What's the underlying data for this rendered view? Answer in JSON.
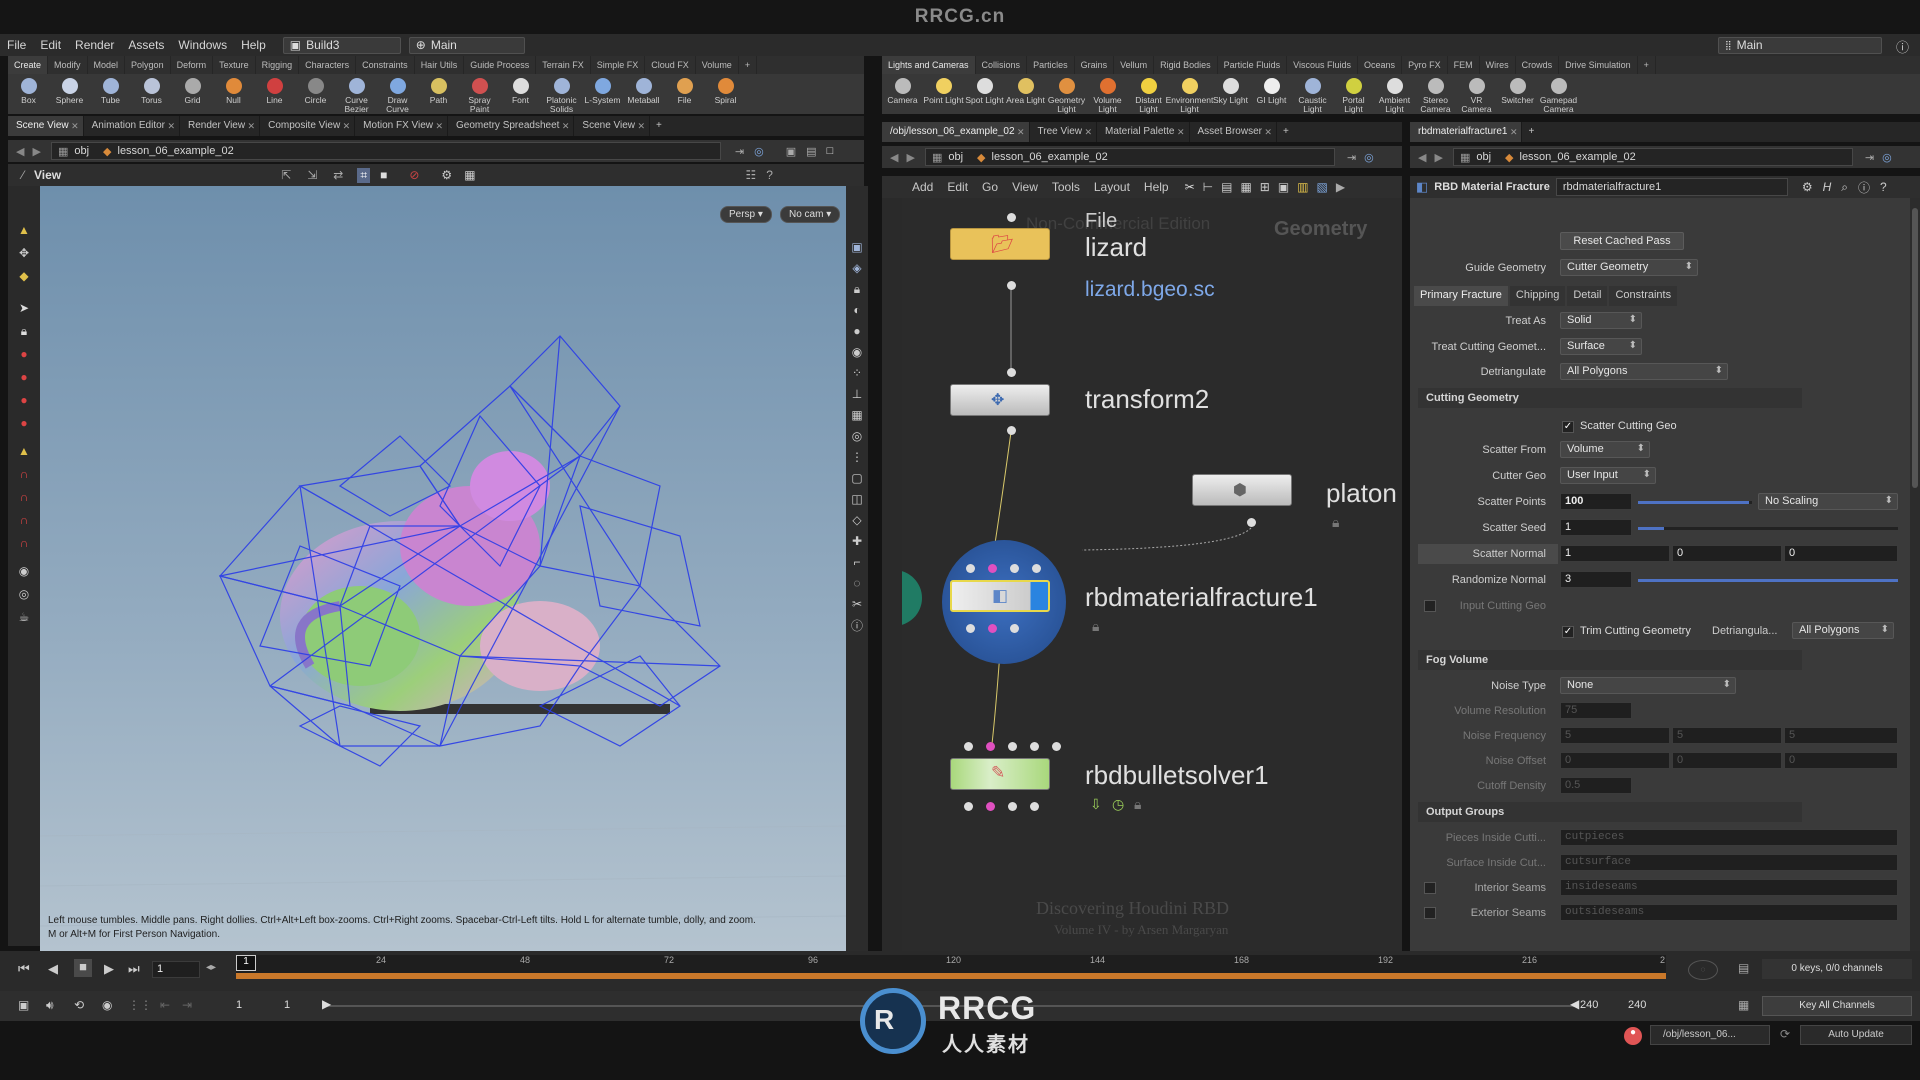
{
  "watermark_title": "RRCG.cn",
  "menubar": {
    "items": [
      "File",
      "Edit",
      "Render",
      "Assets",
      "Windows",
      "Help"
    ],
    "build_desktop": "Build3",
    "main_desktop": "Main",
    "right_desktop": "Main"
  },
  "shelf_left": {
    "tabs": [
      "Create",
      "Modify",
      "Model",
      "Polygon",
      "Deform",
      "Texture",
      "Rigging",
      "Characters",
      "Constraints",
      "Hair Utils",
      "Guide Process",
      "Terrain FX",
      "Simple FX",
      "Cloud FX",
      "Volume"
    ],
    "tools": [
      {
        "label": "Box",
        "icon": "box-icon",
        "color": "#9fb4d8"
      },
      {
        "label": "Sphere",
        "icon": "sphere-icon",
        "color": "#c9d3e6"
      },
      {
        "label": "Tube",
        "icon": "tube-icon",
        "color": "#9fb4d8"
      },
      {
        "label": "Torus",
        "icon": "torus-icon",
        "color": "#b9c3d8"
      },
      {
        "label": "Grid",
        "icon": "grid-icon",
        "color": "#aaaaaa"
      },
      {
        "label": "Null",
        "icon": "null-icon",
        "color": "#e08a3a"
      },
      {
        "label": "Line",
        "icon": "line-icon",
        "color": "#d04040"
      },
      {
        "label": "Circle",
        "icon": "circle-icon",
        "color": "#888888"
      },
      {
        "label": "Curve Bezier",
        "icon": "curve-bezier-icon",
        "color": "#9fb4d8"
      },
      {
        "label": "Draw Curve",
        "icon": "draw-curve-icon",
        "color": "#7fa8e0"
      },
      {
        "label": "Path",
        "icon": "path-icon",
        "color": "#d8c060"
      },
      {
        "label": "Spray Paint",
        "icon": "spray-paint-icon",
        "color": "#d05050"
      },
      {
        "label": "Font",
        "icon": "font-icon",
        "color": "#dddddd"
      },
      {
        "label": "Platonic Solids",
        "icon": "platonic-icon",
        "color": "#9fb4d8"
      },
      {
        "label": "L-System",
        "icon": "lsystem-icon",
        "color": "#7fa8e0"
      },
      {
        "label": "Metaball",
        "icon": "metaball-icon",
        "color": "#9fb4d8"
      },
      {
        "label": "File",
        "icon": "file-icon",
        "color": "#e0a050"
      },
      {
        "label": "Spiral",
        "icon": "spiral-icon",
        "color": "#e08a3a"
      }
    ]
  },
  "shelf_right": {
    "tabs": [
      "Lights and Cameras",
      "Collisions",
      "Particles",
      "Grains",
      "Vellum",
      "Rigid Bodies",
      "Particle Fluids",
      "Viscous Fluids",
      "Oceans",
      "Pyro FX",
      "FEM",
      "Wires",
      "Crowds",
      "Drive Simulation"
    ],
    "tools": [
      {
        "label": "Camera",
        "icon": "camera-icon",
        "color": "#bbbbbb"
      },
      {
        "label": "Point Light",
        "icon": "point-light-icon",
        "color": "#f0d060"
      },
      {
        "label": "Spot Light",
        "icon": "spot-light-icon",
        "color": "#dddddd"
      },
      {
        "label": "Area Light",
        "icon": "area-light-icon",
        "color": "#e0c060"
      },
      {
        "label": "Geometry Light",
        "icon": "geometry-light-icon",
        "color": "#e09040"
      },
      {
        "label": "Volume Light",
        "icon": "volume-light-icon",
        "color": "#e07030"
      },
      {
        "label": "Distant Light",
        "icon": "distant-light-icon",
        "color": "#f0d040"
      },
      {
        "label": "Environment Light",
        "icon": "environment-light-icon",
        "color": "#f0d060"
      },
      {
        "label": "Sky Light",
        "icon": "sky-light-icon",
        "color": "#dddddd"
      },
      {
        "label": "GI Light",
        "icon": "gi-light-icon",
        "color": "#eeeeee"
      },
      {
        "label": "Caustic Light",
        "icon": "caustic-light-icon",
        "color": "#9fb4d8"
      },
      {
        "label": "Portal Light",
        "icon": "portal-light-icon",
        "color": "#d0d040"
      },
      {
        "label": "Ambient Light",
        "icon": "ambient-light-icon",
        "color": "#dddddd"
      },
      {
        "label": "Stereo Camera",
        "icon": "stereo-camera-icon",
        "color": "#bbbbbb"
      },
      {
        "label": "VR Camera",
        "icon": "vr-camera-icon",
        "color": "#bbbbbb"
      },
      {
        "label": "Switcher",
        "icon": "switcher-icon",
        "color": "#bbbbbb"
      },
      {
        "label": "Gamepad Camera",
        "icon": "gamepad-camera-icon",
        "color": "#bbbbbb"
      }
    ]
  },
  "left_pane": {
    "tabs": [
      "Scene View",
      "Animation Editor",
      "Render View",
      "Composite View",
      "Motion FX View",
      "Geometry Spreadsheet",
      "Scene View"
    ],
    "path_root": "obj",
    "path_node": "lesson_06_example_02",
    "view_label": "View",
    "persp_button": "Persp",
    "cam_button": "No cam",
    "hint_line1": "Left mouse tumbles. Middle pans. Right dollies. Ctrl+Alt+Left box-zooms. Ctrl+Right zooms. Spacebar-Ctrl-Left tilts. Hold L for alternate tumble, dolly, and zoom.",
    "hint_line2": "M or Alt+M for First Person Navigation."
  },
  "network_pane": {
    "tabs": [
      "/obj/lesson_06_example_02",
      "Tree View",
      "Material Palette",
      "Asset Browser"
    ],
    "path_root": "obj",
    "path_node": "lesson_06_example_02",
    "menu": [
      "Add",
      "Edit",
      "Go",
      "View",
      "Tools",
      "Layout",
      "Help"
    ],
    "watermark_edition": "Non-Commercial Edition",
    "context_label": "Geometry",
    "nodes": {
      "lizard_name": "lizard",
      "lizard_file_label": "File",
      "lizard_file": "lizard.bgeo.sc",
      "transform_name": "transform2",
      "platon_name": "platon",
      "fracture_name": "rbdmaterialfracture1",
      "solver_name": "rbdbulletsolver1"
    },
    "credit_title": "Discovering Houdini RBD",
    "credit_sub": "Volume IV - by Arsen Margaryan"
  },
  "parm_pane": {
    "tab": "rbdmaterialfracture1",
    "path_root": "obj",
    "path_node": "lesson_06_example_02",
    "node_type": "RBD Material Fracture",
    "node_name": "rbdmaterialfracture1",
    "reset_button": "Reset Cached Pass",
    "guide_geometry_label": "Guide Geometry",
    "guide_geometry_value": "Cutter Geometry",
    "tabs": [
      "Primary Fracture",
      "Chipping",
      "Detail",
      "Constraints"
    ],
    "treat_as_label": "Treat As",
    "treat_as_value": "Solid",
    "treat_cutting_label": "Treat Cutting Geomet...",
    "treat_cutting_value": "Surface",
    "detriangulate_label": "Detriangulate",
    "detriangulate_value": "All Polygons",
    "cutting_geometry_section": "Cutting Geometry",
    "scatter_cutting_geo": "Scatter Cutting Geo",
    "scatter_from_label": "Scatter From",
    "scatter_from_value": "Volume",
    "cutter_geo_label": "Cutter Geo",
    "cutter_geo_value": "User Input",
    "scatter_points_label": "Scatter Points",
    "scatter_points_value": "100",
    "scatter_points_fill": 0.97,
    "no_scaling": "No Scaling",
    "scatter_seed_label": "Scatter Seed",
    "scatter_seed_value": "1",
    "scatter_seed_fill": 0.1,
    "scatter_normal_label": "Scatter Normal",
    "scatter_normal_x": "1",
    "scatter_normal_y": "0",
    "scatter_normal_z": "0",
    "randomize_normal_label": "Randomize Normal",
    "randomize_normal_value": "3",
    "randomize_normal_fill": 1.0,
    "input_cutting_geo": "Input Cutting Geo",
    "trim_cutting_geometry": "Trim Cutting Geometry",
    "trim_detriangulate_label": "Detriangula...",
    "trim_detriangulate_value": "All Polygons",
    "fog_volume_section": "Fog Volume",
    "noise_type_label": "Noise Type",
    "noise_type_value": "None",
    "volume_resolution_label": "Volume Resolution",
    "volume_resolution_value": "75",
    "noise_frequency_label": "Noise Frequency",
    "noise_frequency_x": "5",
    "noise_frequency_y": "5",
    "noise_frequency_z": "5",
    "noise_offset_label": "Noise Offset",
    "noise_offset_x": "0",
    "noise_offset_y": "0",
    "noise_offset_z": "0",
    "cutoff_density_label": "Cutoff Density",
    "cutoff_density_value": "0.5",
    "output_groups_section": "Output Groups",
    "pieces_inside_label": "Pieces Inside Cutti...",
    "pieces_inside_value": "cutpieces",
    "surface_inside_label": "Surface Inside Cut...",
    "surface_inside_value": "cutsurface",
    "interior_seams_label": "Interior Seams",
    "interior_seams_value": "insideseams",
    "exterior_seams_label": "Exterior Seams",
    "exterior_seams_value": "outsideseams"
  },
  "timeline": {
    "current_frame": "1",
    "ticks": [
      "1",
      "24",
      "48",
      "72",
      "96",
      "120",
      "144",
      "168",
      "192",
      "216",
      "2"
    ],
    "start_frame": "1",
    "start_frame2": "1",
    "end_frame": "240",
    "end_frame2": "240",
    "keys_channels": "0 keys, 0/0 channels",
    "key_all_channels": "Key All Channels",
    "status_path": "/obj/lesson_06...",
    "auto_update": "Auto Update"
  },
  "logo": {
    "brand": "RRCG",
    "sub": "人人素材"
  },
  "colors": {
    "timeline_orange": "#c9782a",
    "node_selected": "#e8d84a",
    "ring_blue": "#2d5da8",
    "accent_teal": "#1e8a6e"
  }
}
